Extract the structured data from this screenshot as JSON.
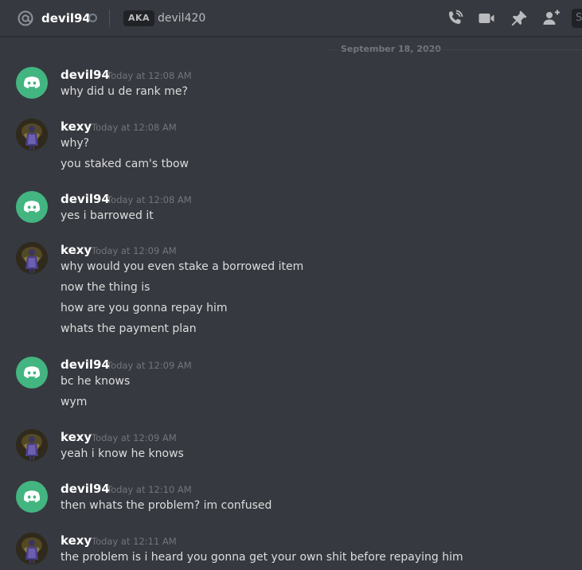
{
  "header": {
    "channel_name": "devil94",
    "aka_label": "AKA",
    "aka_name": "devil420",
    "search_stub": "S"
  },
  "date_divider": "September 18, 2020",
  "messages": [
    {
      "author": "devil94",
      "avatar": "discord-logo",
      "timestamp": "Today at 12:08 AM",
      "lines": [
        "why did u de rank me?"
      ]
    },
    {
      "author": "kexy",
      "avatar": "character-portrait",
      "timestamp": "Today at 12:08 AM",
      "lines": [
        "why?",
        "you staked cam's tbow"
      ]
    },
    {
      "author": "devil94",
      "avatar": "discord-logo",
      "timestamp": "Today at 12:08 AM",
      "lines": [
        "yes i barrowed it"
      ]
    },
    {
      "author": "kexy",
      "avatar": "character-portrait",
      "timestamp": "Today at 12:09 AM",
      "lines": [
        "why would you even stake a borrowed item",
        "now the thing is",
        "how are you gonna repay him",
        "whats the payment plan"
      ]
    },
    {
      "author": "devil94",
      "avatar": "discord-logo",
      "timestamp": "Today at 12:09 AM",
      "lines": [
        "bc he knows",
        "wym"
      ]
    },
    {
      "author": "kexy",
      "avatar": "character-portrait",
      "timestamp": "Today at 12:09 AM",
      "lines": [
        "yeah i know he knows"
      ]
    },
    {
      "author": "devil94",
      "avatar": "discord-logo",
      "timestamp": "Today at 12:10 AM",
      "lines": [
        "then whats the problem? im confused"
      ]
    },
    {
      "author": "kexy",
      "avatar": "character-portrait",
      "timestamp": "Today at 12:11 AM",
      "lines": [
        "the problem is i heard you gonna get your own shit before repaying him"
      ]
    }
  ],
  "colors": {
    "background": "#36393f",
    "header_text": "#ffffff",
    "message_text": "#dcddde",
    "timestamp": "#72767d",
    "discord_avatar": "#43b581",
    "icon": "#b9bbbe"
  }
}
